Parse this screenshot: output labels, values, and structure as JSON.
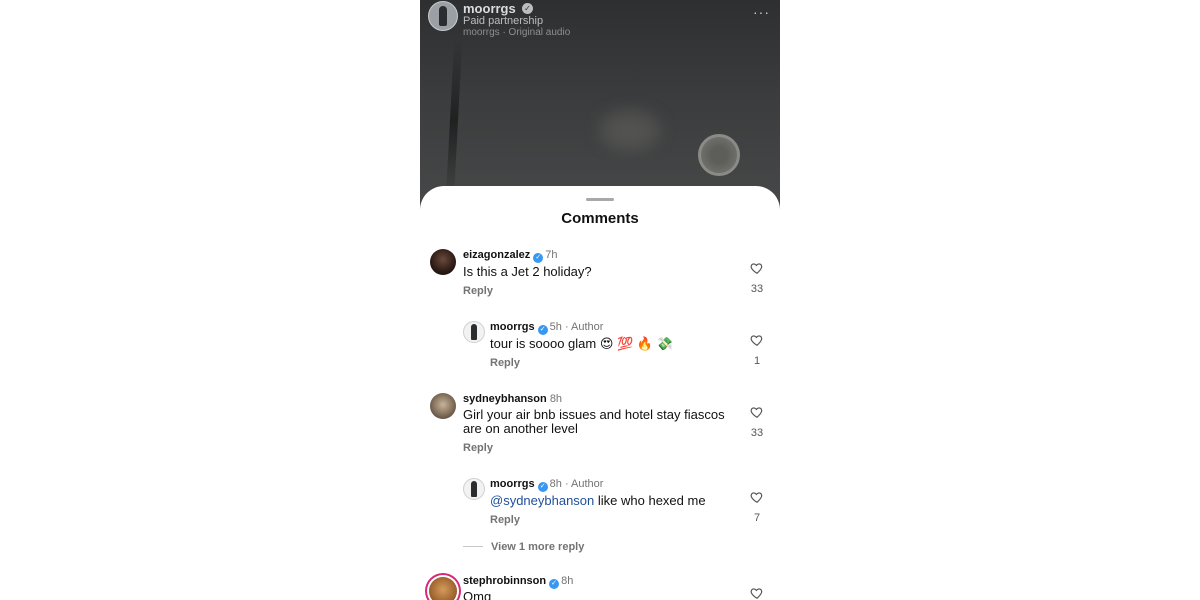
{
  "post": {
    "username": "moorrgs",
    "partnership": "Paid partnership",
    "audio": "moorrgs · Original audio",
    "more_label": "···"
  },
  "sheet": {
    "title": "Comments"
  },
  "comments": [
    {
      "username": "eizagonzalez",
      "time": "7h",
      "text": "Is this a Jet 2 holiday?",
      "reply_label": "Reply",
      "likes": "33"
    },
    {
      "username": "moorrgs",
      "time": "5h",
      "author": "· Author",
      "text": "tour is soooo glam 😍 💯 🔥 💸",
      "reply_label": "Reply",
      "likes": "1"
    },
    {
      "username": "sydneybhanson",
      "time": "8h",
      "text": "Girl your air bnb issues and hotel stay fiascos are on another level",
      "reply_label": "Reply",
      "likes": "33"
    },
    {
      "username": "moorrgs",
      "time": "8h",
      "author": "· Author",
      "mention": "@sydneybhanson",
      "text": " like who hexed me",
      "reply_label": "Reply",
      "likes": "7"
    },
    {
      "username": "stephrobinnson",
      "time": "8h",
      "text": "Omg"
    }
  ],
  "view_more": "View 1 more reply",
  "icons": {
    "verified": "verified-badge-icon",
    "like": "heart-outline-icon",
    "more": "more-horizontal-icon"
  },
  "colors": {
    "verified_blue": "#3897f0",
    "mention_blue": "#1f4f9a",
    "story_ring": "#d62976"
  }
}
